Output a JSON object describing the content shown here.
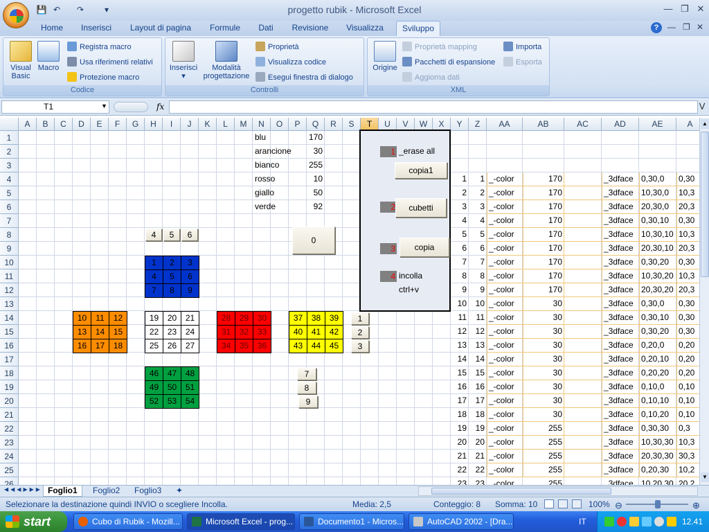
{
  "app": {
    "title": "progetto rubik - Microsoft Excel",
    "qat": [
      "save-icon",
      "undo-icon",
      "redo-icon",
      "customize-icon"
    ]
  },
  "tabs": [
    "Home",
    "Inserisci",
    "Layout di pagina",
    "Formule",
    "Dati",
    "Revisione",
    "Visualizza",
    "Sviluppo"
  ],
  "ribbon": {
    "codice": {
      "label": "Codice",
      "visual_basic": "Visual Basic",
      "macro": "Macro",
      "registra": "Registra macro",
      "usa_rif": "Usa riferimenti relativi",
      "protezione": "Protezione macro"
    },
    "controlli": {
      "label": "Controlli",
      "inserisci": "Inserisci",
      "modalita": "Modalità progettazione",
      "proprieta": "Proprietà",
      "visualizza": "Visualizza codice",
      "esegui": "Esegui finestra di dialogo"
    },
    "xml": {
      "label": "XML",
      "origine": "Origine",
      "prop_mapping": "Proprietà mapping",
      "pacchetti": "Pacchetti di espansione",
      "aggiorna": "Aggiorna dati",
      "importa": "Importa",
      "esporta": "Esporta"
    }
  },
  "formula_bar": {
    "name_box": "T1",
    "fx": "fx",
    "formula": ""
  },
  "columns": [
    "A",
    "B",
    "C",
    "D",
    "E",
    "F",
    "G",
    "H",
    "I",
    "J",
    "K",
    "L",
    "M",
    "N",
    "O",
    "P",
    "Q",
    "R",
    "S",
    "T",
    "U",
    "V",
    "W",
    "X",
    "Y",
    "Z",
    "AA",
    "AB",
    "AC",
    "AD",
    "AE",
    "A"
  ],
  "rows": [
    "1",
    "2",
    "3",
    "4",
    "5",
    "6",
    "7",
    "8",
    "9",
    "10",
    "11",
    "12",
    "13",
    "14",
    "15",
    "16",
    "17",
    "18",
    "19",
    "20",
    "21",
    "22",
    "23",
    "24",
    "25",
    "26"
  ],
  "colors_table": [
    {
      "name": "blu",
      "value": "170"
    },
    {
      "name": "arancione",
      "value": "30"
    },
    {
      "name": "bianco",
      "value": "255"
    },
    {
      "name": "rosso",
      "value": "10"
    },
    {
      "name": "giallo",
      "value": "50"
    },
    {
      "name": "verde",
      "value": "92"
    }
  ],
  "faces": {
    "blue": [
      "1",
      "2",
      "3",
      "4",
      "5",
      "6",
      "7",
      "8",
      "9"
    ],
    "orange": [
      "10",
      "11",
      "12",
      "13",
      "14",
      "15",
      "16",
      "17",
      "18"
    ],
    "white": [
      "19",
      "20",
      "21",
      "22",
      "23",
      "24",
      "25",
      "26",
      "27"
    ],
    "red": [
      "28",
      "29",
      "30",
      "31",
      "32",
      "33",
      "34",
      "35",
      "36"
    ],
    "yellow": [
      "37",
      "38",
      "39",
      "40",
      "41",
      "42",
      "43",
      "44",
      "45"
    ],
    "green": [
      "46",
      "47",
      "48",
      "49",
      "50",
      "51",
      "52",
      "53",
      "54"
    ]
  },
  "face_colors": {
    "blue": "#0033cc",
    "orange": "#ff8c00",
    "white": "#ffffff",
    "red": "#ff0000",
    "yellow": "#ffff00",
    "green": "#00a040"
  },
  "buttons": {
    "top": [
      "4",
      "5",
      "6"
    ],
    "zero": "0",
    "side": [
      "1",
      "2",
      "3"
    ],
    "bottom": [
      "7",
      "8",
      "9"
    ],
    "copia1": "copia1",
    "cubetti": "cubetti",
    "copia": "copia"
  },
  "panel": {
    "step1_num": "1",
    "step1_text": "_erase   all",
    "step2_num": "2",
    "step3_num": "3",
    "step4_num": "4",
    "step4_text": "incolla",
    "step4_sub": "ctrl+v"
  },
  "data_rows": [
    {
      "y": "1",
      "z": "1",
      "aa": "_-color",
      "ab": "170",
      "ad": "_3dface",
      "ae": "0,30,0",
      "af": "0,30"
    },
    {
      "y": "2",
      "z": "2",
      "aa": "_-color",
      "ab": "170",
      "ad": "_3dface",
      "ae": "10,30,0",
      "af": "10,3"
    },
    {
      "y": "3",
      "z": "3",
      "aa": "_-color",
      "ab": "170",
      "ad": "_3dface",
      "ae": "20,30,0",
      "af": "20,3"
    },
    {
      "y": "4",
      "z": "4",
      "aa": "_-color",
      "ab": "170",
      "ad": "_3dface",
      "ae": "0,30,10",
      "af": "0,30"
    },
    {
      "y": "5",
      "z": "5",
      "aa": "_-color",
      "ab": "170",
      "ad": "_3dface",
      "ae": "10,30,10",
      "af": "10,3"
    },
    {
      "y": "6",
      "z": "6",
      "aa": "_-color",
      "ab": "170",
      "ad": "_3dface",
      "ae": "20,30,10",
      "af": "20,3"
    },
    {
      "y": "7",
      "z": "7",
      "aa": "_-color",
      "ab": "170",
      "ad": "_3dface",
      "ae": "0,30,20",
      "af": "0,30"
    },
    {
      "y": "8",
      "z": "8",
      "aa": "_-color",
      "ab": "170",
      "ad": "_3dface",
      "ae": "10,30,20",
      "af": "10,3"
    },
    {
      "y": "9",
      "z": "9",
      "aa": "_-color",
      "ab": "170",
      "ad": "_3dface",
      "ae": "20,30,20",
      "af": "20,3"
    },
    {
      "y": "10",
      "z": "10",
      "aa": "_-color",
      "ab": "30",
      "ad": "_3dface",
      "ae": "0,30,0",
      "af": "0,30"
    },
    {
      "y": "11",
      "z": "11",
      "aa": "_-color",
      "ab": "30",
      "ad": "_3dface",
      "ae": "0,30,10",
      "af": "0,30"
    },
    {
      "y": "12",
      "z": "12",
      "aa": "_-color",
      "ab": "30",
      "ad": "_3dface",
      "ae": "0,30,20",
      "af": "0,30"
    },
    {
      "y": "13",
      "z": "13",
      "aa": "_-color",
      "ab": "30",
      "ad": "_3dface",
      "ae": "0,20,0",
      "af": "0,20"
    },
    {
      "y": "14",
      "z": "14",
      "aa": "_-color",
      "ab": "30",
      "ad": "_3dface",
      "ae": "0,20,10",
      "af": "0,20"
    },
    {
      "y": "15",
      "z": "15",
      "aa": "_-color",
      "ab": "30",
      "ad": "_3dface",
      "ae": "0,20,20",
      "af": "0,20"
    },
    {
      "y": "16",
      "z": "16",
      "aa": "_-color",
      "ab": "30",
      "ad": "_3dface",
      "ae": "0,10,0",
      "af": "0,10"
    },
    {
      "y": "17",
      "z": "17",
      "aa": "_-color",
      "ab": "30",
      "ad": "_3dface",
      "ae": "0,10,10",
      "af": "0,10"
    },
    {
      "y": "18",
      "z": "18",
      "aa": "_-color",
      "ab": "30",
      "ad": "_3dface",
      "ae": "0,10,20",
      "af": "0,10"
    },
    {
      "y": "19",
      "z": "19",
      "aa": "_-color",
      "ab": "255",
      "ad": "_3dface",
      "ae": "0,30,30",
      "af": "0,3"
    },
    {
      "y": "20",
      "z": "20",
      "aa": "_-color",
      "ab": "255",
      "ad": "_3dface",
      "ae": "10,30,30",
      "af": "10,3"
    },
    {
      "y": "21",
      "z": "21",
      "aa": "_-color",
      "ab": "255",
      "ad": "_3dface",
      "ae": "20,30,30",
      "af": "30,3"
    },
    {
      "y": "22",
      "z": "22",
      "aa": "_-color",
      "ab": "255",
      "ad": "_3dface",
      "ae": "0,20,30",
      "af": "10,2"
    },
    {
      "y": "23",
      "z": "23",
      "aa": "_-color",
      "ab": "255",
      "ad": "_3dface",
      "ae": "10,20,30",
      "af": "20,2"
    }
  ],
  "sheets": [
    "Foglio1",
    "Foglio2",
    "Foglio3"
  ],
  "status": {
    "message": "Selezionare la destinazione quindi INVIO o scegliere Incolla.",
    "media": "Media: 2,5",
    "conteggio": "Conteggio: 8",
    "somma": "Somma: 10",
    "zoom": "100%"
  },
  "taskbar": {
    "start": "start",
    "tasks": [
      "Cubo di Rubik - Mozill...",
      "Microsoft Excel - prog...",
      "Documento1 - Micros...",
      "AutoCAD 2002 - [Dra..."
    ],
    "lang": "IT",
    "clock": "12.41"
  }
}
